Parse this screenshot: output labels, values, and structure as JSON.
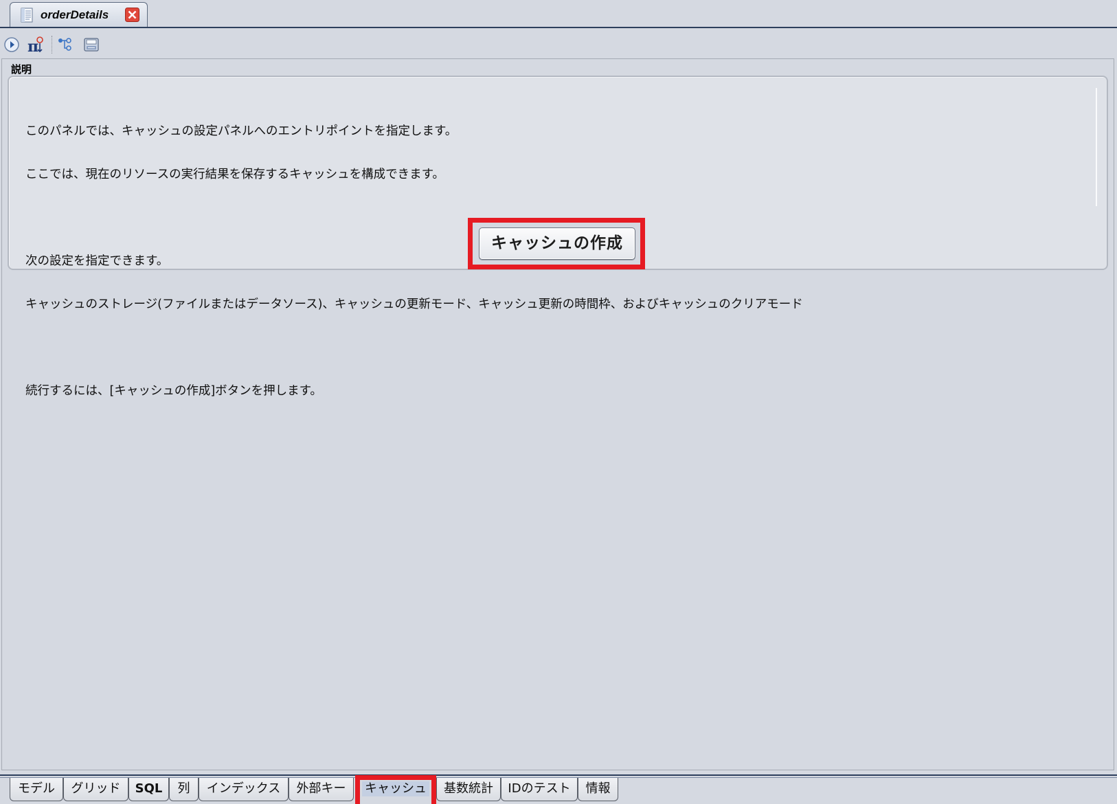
{
  "editor_tab": {
    "title": "orderDetails",
    "icon": "document-icon",
    "close_icon": "close-icon"
  },
  "toolbar": {
    "buttons": [
      {
        "name": "run-icon"
      },
      {
        "name": "pi-query-icon"
      },
      {
        "name": "tree-icon"
      },
      {
        "name": "save-icon"
      }
    ]
  },
  "section": {
    "label": "説明"
  },
  "description": {
    "line1": "このパネルでは、キャッシュの設定パネルへのエントリポイントを指定します。",
    "line2": "ここでは、現在のリソースの実行結果を保存するキャッシュを構成できます。",
    "line3": "次の設定を指定できます。",
    "line4": "キャッシュのストレージ(ファイルまたはデータソース)、キャッシュの更新モード、キャッシュ更新の時間枠、およびキャッシュのクリアモード",
    "line5": "続行するには、[キャッシュの作成]ボタンを押します。"
  },
  "create_button": {
    "label": "キャッシュの作成"
  },
  "bottom_tabs": [
    {
      "label": "モデル"
    },
    {
      "label": "グリッド"
    },
    {
      "label": "SQL"
    },
    {
      "label": "列"
    },
    {
      "label": "インデックス"
    },
    {
      "label": "外部キー"
    },
    {
      "label": "キャッシュ"
    },
    {
      "label": "基数統計"
    },
    {
      "label": "IDのテスト"
    },
    {
      "label": "情報"
    }
  ],
  "active_tab": "キャッシュ",
  "colors": {
    "background": "#d5d9e1",
    "highlight": "#e61b23",
    "tab_line": "#2d3f5c"
  }
}
